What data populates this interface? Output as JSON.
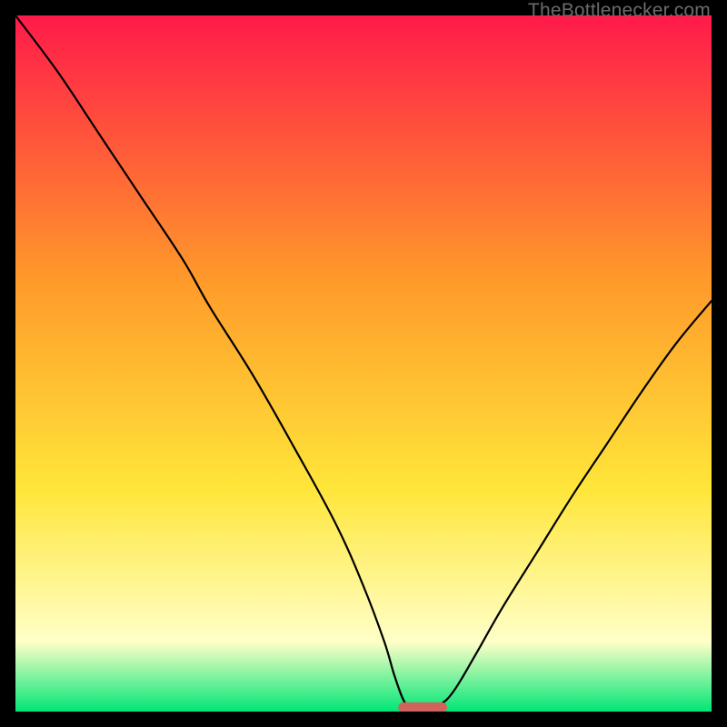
{
  "watermark": "TheBottlenecker.com",
  "colors": {
    "gradient_top": "#ff1a4a",
    "gradient_mid1": "#ff9a2a",
    "gradient_mid2": "#ffe63a",
    "gradient_pale": "#ffffc8",
    "gradient_bottom": "#00e676",
    "line": "#000000",
    "marker": "#d0635b",
    "frame_bg": "#000000"
  },
  "chart_data": {
    "type": "line",
    "title": "",
    "xlabel": "",
    "ylabel": "",
    "xlim": [
      0,
      100
    ],
    "ylim": [
      0,
      100
    ],
    "x": [
      0,
      6,
      12,
      18,
      24,
      28,
      34,
      40,
      46,
      50,
      53,
      54.5,
      56,
      57.5,
      59,
      61,
      63,
      66,
      70,
      75,
      80,
      85,
      90,
      95,
      100
    ],
    "y": [
      100,
      92,
      83,
      74,
      65,
      58,
      48.5,
      38,
      27,
      18,
      10,
      5,
      1.2,
      0.6,
      0.6,
      1.0,
      3,
      8,
      15,
      23,
      31,
      38.5,
      46,
      53,
      59
    ],
    "flat_segment": {
      "x0": 56.5,
      "x1": 60.5,
      "y": 0.6
    },
    "marker": {
      "x0": 55,
      "x1": 62,
      "y": 0.6
    }
  }
}
